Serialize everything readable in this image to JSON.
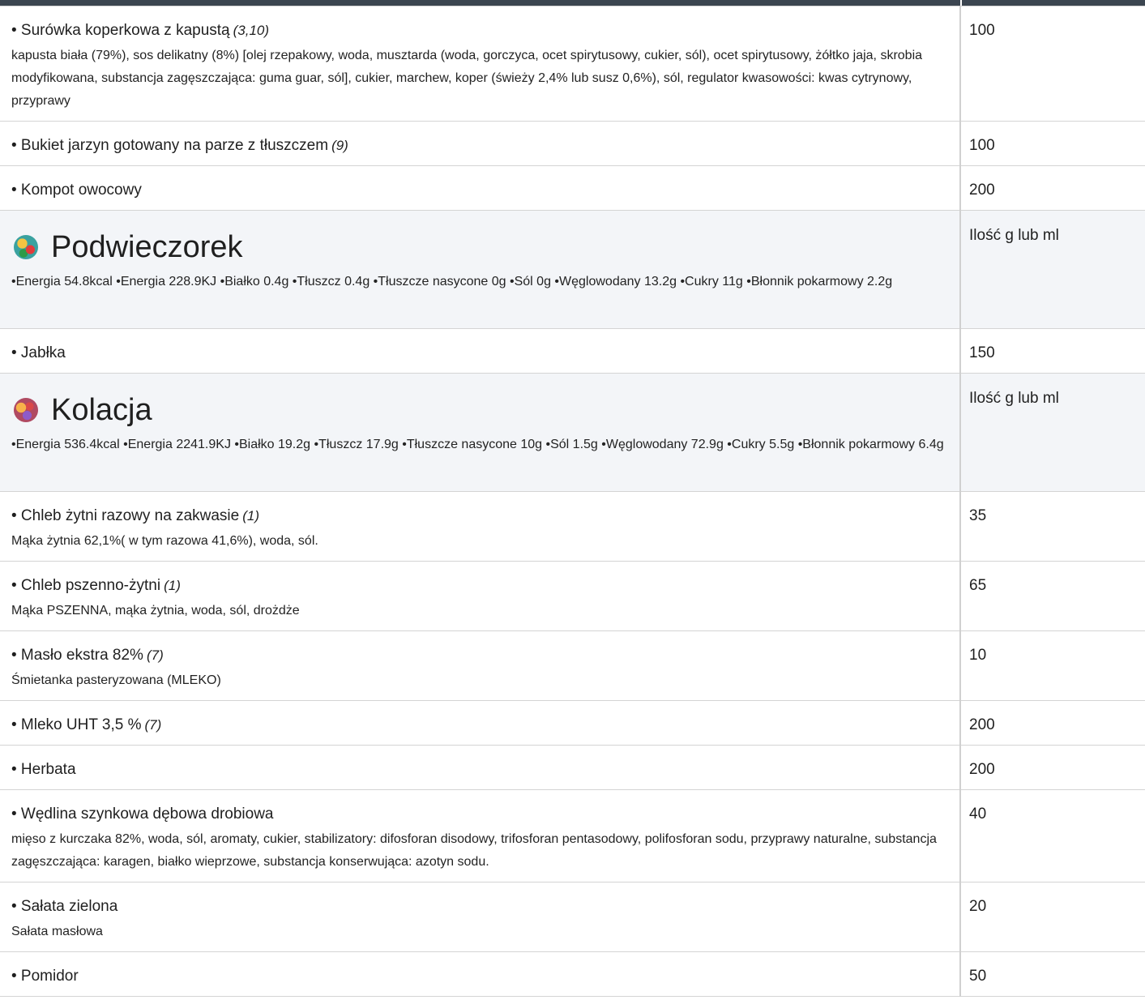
{
  "rows_top": [
    {
      "name": "• Surówka koperkowa z kapustą",
      "allergens": "(3,10)",
      "ingredients": "kapusta biała (79%), sos delikatny (8%) [olej rzepakowy, woda, musztarda (woda, gorczyca, ocet spirytusowy, cukier, sól), ocet spirytusowy, żółtko jaja, skrobia modyfikowana, substancja zagęszczająca: guma guar, sól], cukier, marchew, koper (świeży 2,4% lub susz 0,6%), sól, regulator kwasowości: kwas cytrynowy, przyprawy",
      "qty": "100"
    },
    {
      "name": "• Bukiet jarzyn gotowany na parze z tłuszczem",
      "allergens": "(9)",
      "ingredients": "",
      "qty": "100"
    },
    {
      "name": "• Kompot owocowy",
      "allergens": "",
      "ingredients": "",
      "qty": "200"
    }
  ],
  "snack": {
    "title": "Podwieczorek",
    "icon": "fruit-bowl-icon",
    "qty_header": "Ilość g lub ml",
    "nutrition": "•Energia 54.8kcal •Energia 228.9KJ •Białko 0.4g •Tłuszcz 0.4g •Tłuszcze nasycone 0g •Sól 0g •Węglowodany 13.2g •Cukry 11g •Błonnik pokarmowy 2.2g",
    "items": [
      {
        "name": "• Jabłka",
        "allergens": "",
        "ingredients": "",
        "qty": "150"
      }
    ]
  },
  "supper": {
    "title": "Kolacja",
    "icon": "dinner-plate-icon",
    "qty_header": "Ilość g lub ml",
    "nutrition": "•Energia 536.4kcal •Energia 2241.9KJ •Białko 19.2g •Tłuszcz 17.9g •Tłuszcze nasycone 10g •Sól 1.5g •Węglowodany 72.9g •Cukry 5.5g •Błonnik pokarmowy 6.4g",
    "items": [
      {
        "name": "• Chleb żytni razowy na zakwasie",
        "allergens": "(1)",
        "ingredients": "Mąka żytnia 62,1%( w tym razowa 41,6%), woda, sól.",
        "qty": "35"
      },
      {
        "name": "• Chleb pszenno-żytni",
        "allergens": "(1)",
        "ingredients": "Mąka PSZENNA, mąka żytnia, woda, sól, drożdże",
        "qty": "65"
      },
      {
        "name": "• Masło ekstra 82%",
        "allergens": "(7)",
        "ingredients": "Śmietanka pasteryzowana (MLEKO)",
        "qty": "10"
      },
      {
        "name": "• Mleko UHT 3,5 %",
        "allergens": "(7)",
        "ingredients": "",
        "qty": "200"
      },
      {
        "name": "• Herbata",
        "allergens": "",
        "ingredients": "",
        "qty": "200"
      },
      {
        "name": "• Wędlina szynkowa dębowa drobiowa",
        "allergens": "",
        "ingredients": "mięso z kurczaka 82%, woda, sól, aromaty, cukier, stabilizatory: difosforan disodowy, trifosforan pentasodowy, polifosforan sodu, przyprawy naturalne, substancja zagęszczająca: karagen, białko wieprzowe, substancja konserwująca: azotyn sodu.",
        "qty": "40"
      },
      {
        "name": "• Sałata zielona",
        "allergens": "",
        "ingredients": "Sałata masłowa",
        "qty": "20"
      },
      {
        "name": "• Pomidor",
        "allergens": "",
        "ingredients": "",
        "qty": "50"
      }
    ]
  }
}
